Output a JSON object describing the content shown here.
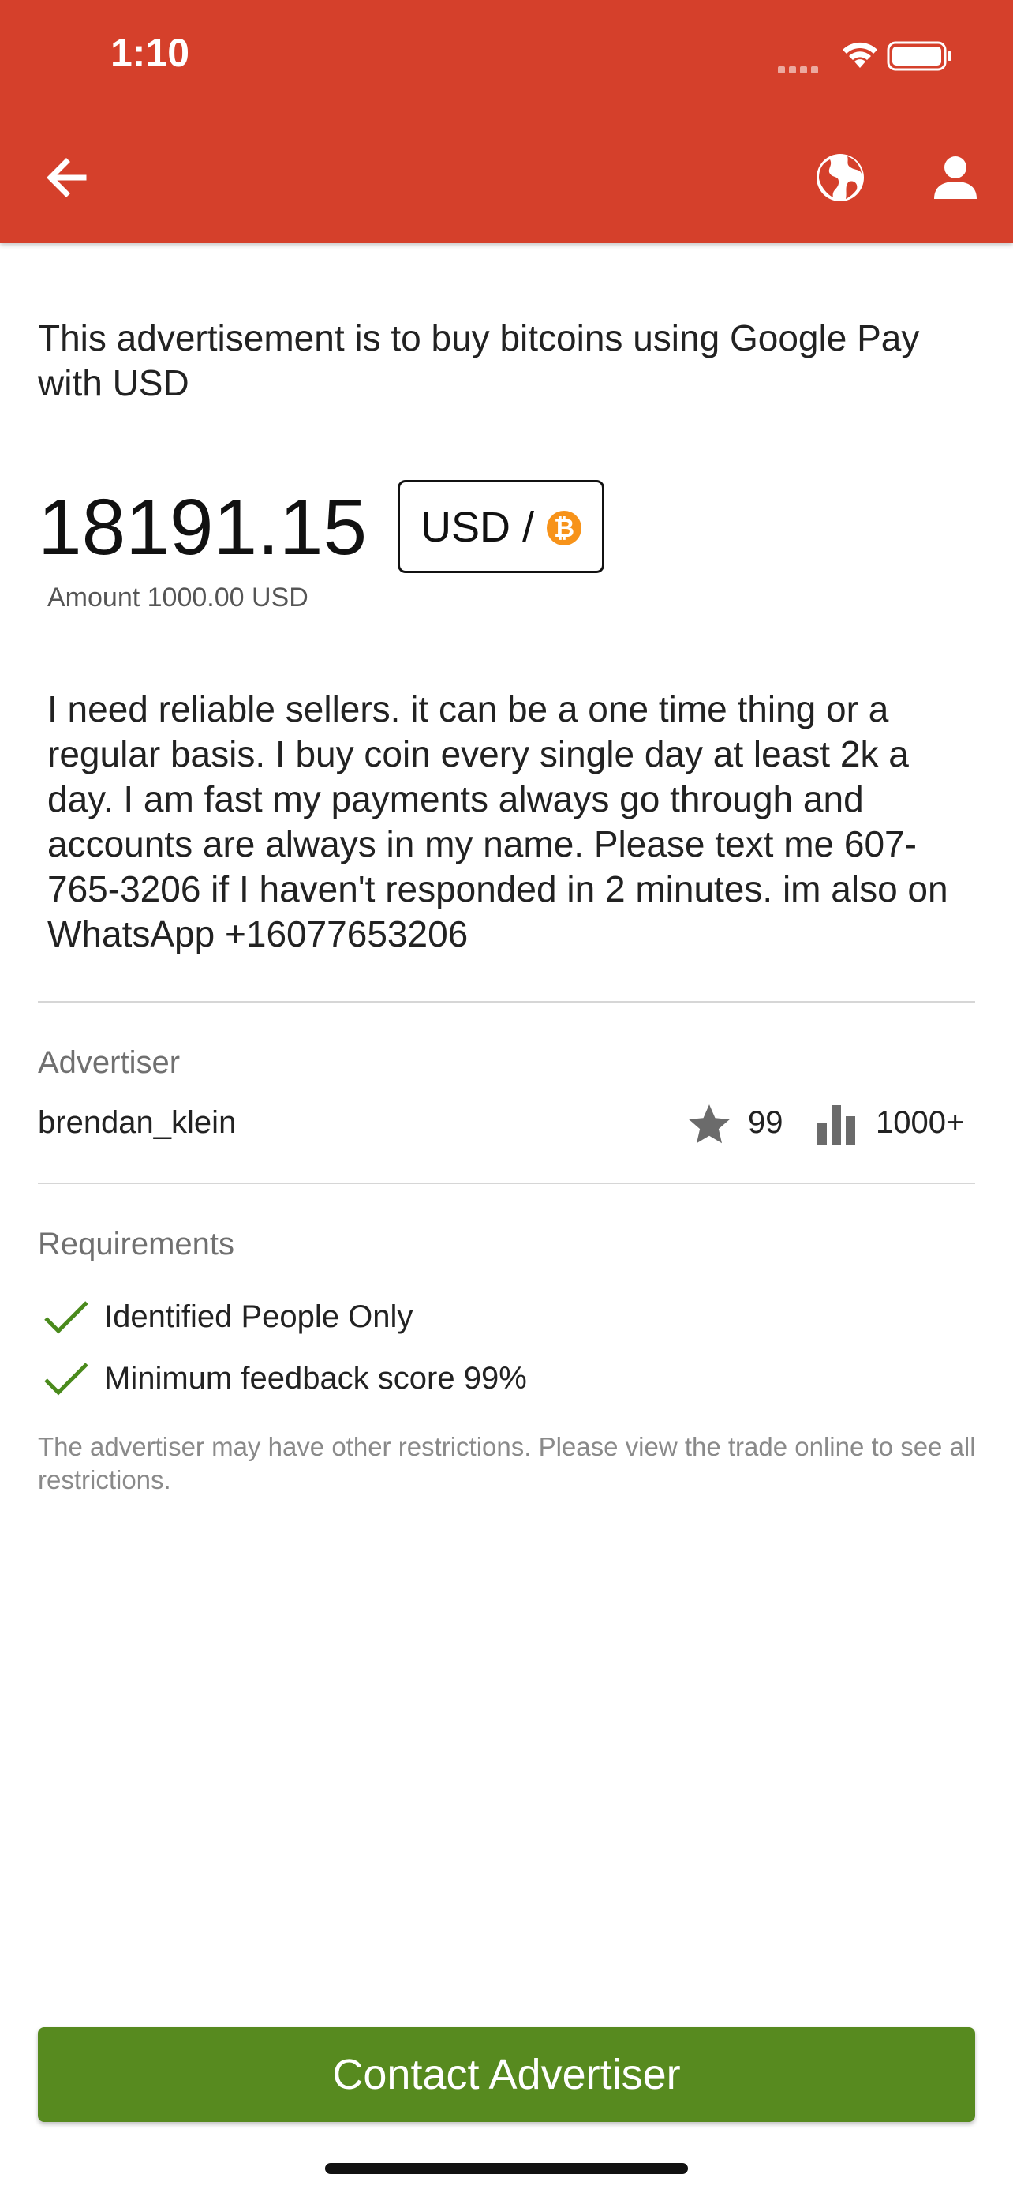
{
  "status_bar": {
    "time": "1:10"
  },
  "header": {
    "back_icon": "arrow-left-icon",
    "globe_icon": "globe-icon",
    "user_icon": "user-icon",
    "background_color": "#d5402b"
  },
  "advertisement": {
    "title": "This advertisement is to buy bitcoins using Google Pay with USD",
    "price": "18191.15",
    "currency_label": "USD /",
    "currency_icon": "bitcoin-icon",
    "amount": "Amount 1000.00 USD",
    "description": "I need reliable sellers. it can be a one time thing or a regular basis. I buy coin every single day at least 2k a day. I am fast my payments always go through and accounts are always in my name. Please text me 607-765-3206 if I haven't responded in 2 minutes. im also on WhatsApp +16077653206"
  },
  "advertiser": {
    "label": "Advertiser",
    "name": "brendan_klein",
    "feedback_score": "99",
    "trade_count": "1000+"
  },
  "requirements": {
    "label": "Requirements",
    "items": [
      "Identified People Only",
      "Minimum feedback score 99%"
    ],
    "note": "The advertiser may have other restrictions. Please view the trade online to see all restrictions."
  },
  "actions": {
    "contact_label": "Contact Advertiser",
    "contact_color": "#578a1f"
  }
}
